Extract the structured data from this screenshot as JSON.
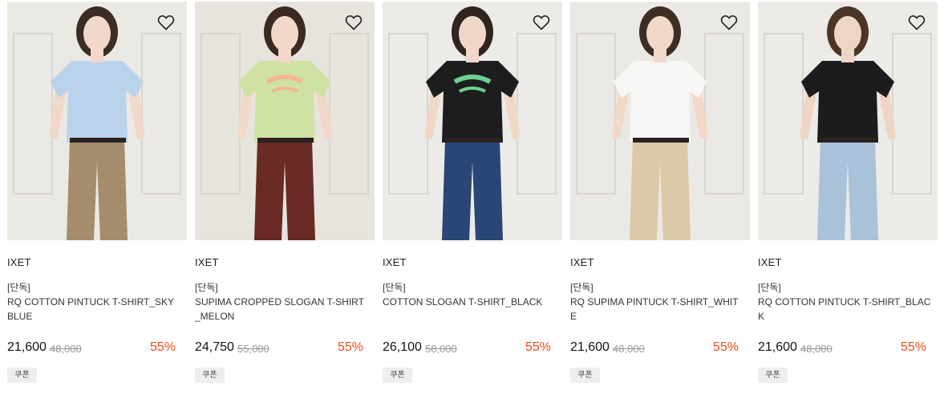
{
  "products": [
    {
      "brand": "IXET",
      "tag": "[단독]",
      "name": "RQ COTTON PINTUCK T-SHIRT_SKY BLUE",
      "price": "21,600",
      "original_price": "48,000",
      "discount": "55%",
      "coupon": "쿠폰",
      "icon": "heart-outline",
      "palette": {
        "bg": "#ebe9e4",
        "top": "#b9d3ec",
        "bottom": "#a48c6c",
        "hair": "#3b2c25",
        "skin": "#f2d8c9",
        "print": ""
      }
    },
    {
      "brand": "IXET",
      "tag": "[단독]",
      "name": "SUPIMA CROPPED SLOGAN T-SHIRT_MELON",
      "price": "24,750",
      "original_price": "55,000",
      "discount": "55%",
      "coupon": "쿠폰",
      "icon": "heart-outline",
      "palette": {
        "bg": "#e7e4de",
        "top": "#cfe2a3",
        "bottom": "#6a2a24",
        "hair": "#3a2a22",
        "skin": "#f2d8c9",
        "print": "#f3b690"
      }
    },
    {
      "brand": "IXET",
      "tag": "[단독]",
      "name": "COTTON SLOGAN T-SHIRT_BLACK",
      "price": "26,100",
      "original_price": "58,000",
      "discount": "55%",
      "coupon": "쿠폰",
      "icon": "heart-outline",
      "palette": {
        "bg": "#ecebe8",
        "top": "#1d1d1f",
        "bottom": "#2a4677",
        "hair": "#2f241f",
        "skin": "#f1d7c7",
        "print": "#6fcf8e"
      }
    },
    {
      "brand": "IXET",
      "tag": "[단독]",
      "name": "RQ SUPIMA PINTUCK T-SHIRT_WHITE",
      "price": "21,600",
      "original_price": "48,000",
      "discount": "55%",
      "coupon": "쿠폰",
      "icon": "heart-outline",
      "palette": {
        "bg": "#ebe9e5",
        "top": "#f7f7f5",
        "bottom": "#dcc9a8",
        "hair": "#3e2d25",
        "skin": "#f2d8c9",
        "print": ""
      }
    },
    {
      "brand": "IXET",
      "tag": "[단독]",
      "name": "RQ COTTON PINTUCK T-SHIRT_BLACK",
      "price": "21,600",
      "original_price": "48,000",
      "discount": "55%",
      "coupon": "쿠폰",
      "icon": "heart-outline",
      "palette": {
        "bg": "#ecebe8",
        "top": "#1c1c1e",
        "bottom": "#a9c2da",
        "hair": "#4a3528",
        "skin": "#efd5c4",
        "print": ""
      }
    }
  ],
  "colors": {
    "discount": "#f04a17",
    "original_price": "#999999",
    "coupon_bg": "#eeeeee"
  }
}
